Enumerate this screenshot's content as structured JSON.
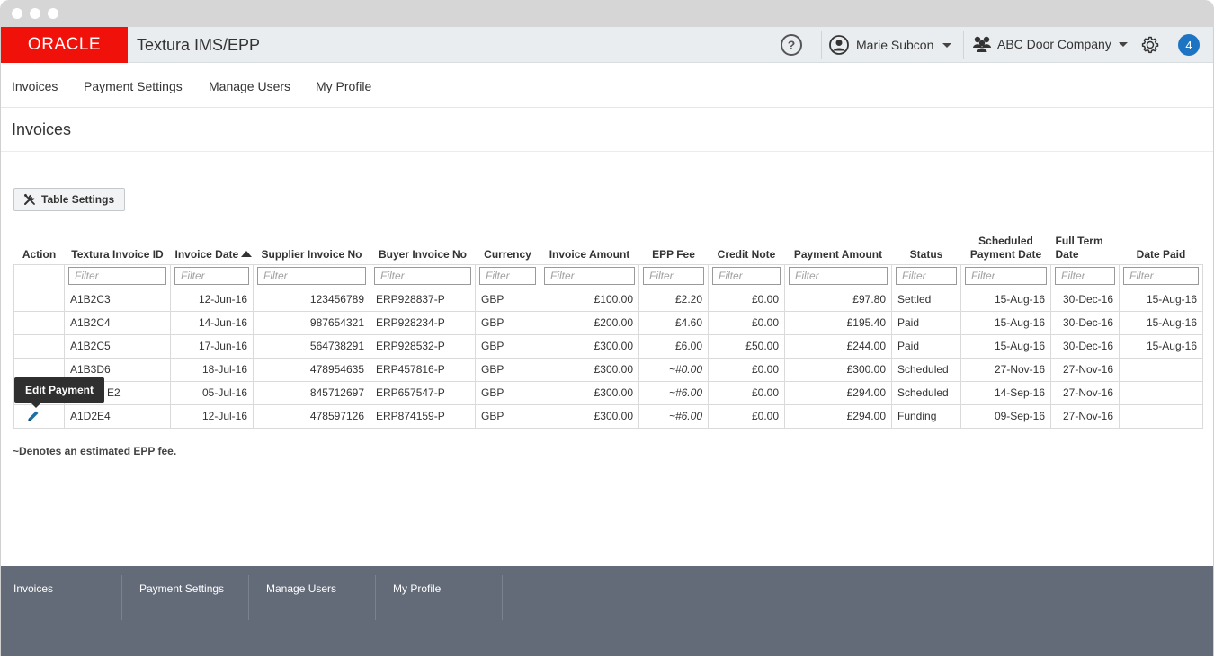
{
  "header": {
    "logo": "ORACLE",
    "app_title": "Textura IMS/EPP",
    "help_glyph": "?",
    "user_name": "Marie Subcon",
    "company_name": "ABC Door Company",
    "notification_count": "4",
    "brand_color": "#f0110a",
    "accent_color": "#1d74c2"
  },
  "nav": {
    "items": [
      "Invoices",
      "Payment Settings",
      "Manage Users",
      "My Profile"
    ]
  },
  "page": {
    "title": "Invoices",
    "table_settings_label": "Table Settings",
    "tooltip": "Edit Payment",
    "footnote": "~Denotes an estimated EPP fee."
  },
  "table": {
    "columns": [
      "Action",
      "Textura Invoice ID",
      "Invoice Date",
      "Supplier Invoice No",
      "Buyer Invoice No",
      "Currency",
      "Invoice Amount",
      "EPP Fee",
      "Credit Note",
      "Payment Amount",
      "Status",
      "Scheduled Payment Date",
      "Full Term Date",
      "Date Paid"
    ],
    "filter_placeholder": "Filter",
    "rows": [
      {
        "id": "A1B2C3",
        "invoice_date": "12-Jun-16",
        "supplier_no": "123456789",
        "buyer_no": "ERP928837-P",
        "currency": "GBP",
        "amount": "£100.00",
        "epp_fee": "£2.20",
        "credit_note": "£0.00",
        "payment": "£97.80",
        "status": "Settled",
        "scheduled": "15-Aug-16",
        "full_term": "30-Dec-16",
        "paid": "15-Aug-16"
      },
      {
        "id": "A1B2C4",
        "invoice_date": "14-Jun-16",
        "supplier_no": "987654321",
        "buyer_no": "ERP928234-P",
        "currency": "GBP",
        "amount": "£200.00",
        "epp_fee": "£4.60",
        "credit_note": "£0.00",
        "payment": "£195.40",
        "status": "Paid",
        "scheduled": "15-Aug-16",
        "full_term": "30-Dec-16",
        "paid": "15-Aug-16"
      },
      {
        "id": "A1B2C5",
        "invoice_date": "17-Jun-16",
        "supplier_no": "564738291",
        "buyer_no": "ERP928532-P",
        "currency": "GBP",
        "amount": "£300.00",
        "epp_fee": "£6.00",
        "credit_note": "£50.00",
        "payment": "£244.00",
        "status": "Paid",
        "scheduled": "15-Aug-16",
        "full_term": "30-Dec-16",
        "paid": "15-Aug-16"
      },
      {
        "id": "A1B3D6",
        "invoice_date": "18-Jul-16",
        "supplier_no": "478954635",
        "buyer_no": "ERP457816-P",
        "currency": "GBP",
        "amount": "£300.00",
        "epp_fee": "~#0.00",
        "credit_note": "£0.00",
        "payment": "£300.00",
        "status": "Scheduled",
        "scheduled": "27-Nov-16",
        "full_term": "27-Nov-16",
        "paid": ""
      },
      {
        "id": "E2",
        "invoice_date": "05-Jul-16",
        "supplier_no": "845712697",
        "buyer_no": "ERP657547-P",
        "currency": "GBP",
        "amount": "£300.00",
        "epp_fee": "~#6.00",
        "credit_note": "£0.00",
        "payment": "£294.00",
        "status": "Scheduled",
        "scheduled": "14-Sep-16",
        "full_term": "27-Nov-16",
        "paid": ""
      },
      {
        "id": "A1D2E4",
        "invoice_date": "12-Jul-16",
        "supplier_no": "478597126",
        "buyer_no": "ERP874159-P",
        "currency": "GBP",
        "amount": "£300.00",
        "epp_fee": "~#6.00",
        "credit_note": "£0.00",
        "payment": "£294.00",
        "status": "Funding",
        "scheduled": "09-Sep-16",
        "full_term": "27-Nov-16",
        "paid": ""
      }
    ]
  },
  "footer": {
    "items": [
      "Invoices",
      "Payment Settings",
      "Manage Users",
      "My Profile"
    ]
  },
  "icons": {
    "help": "help-icon",
    "user": "user-icon",
    "company": "group-icon",
    "settings": "gear-icon",
    "table_settings": "tools-icon",
    "sort": "sort-ascending-icon",
    "edit": "pencil-icon"
  }
}
